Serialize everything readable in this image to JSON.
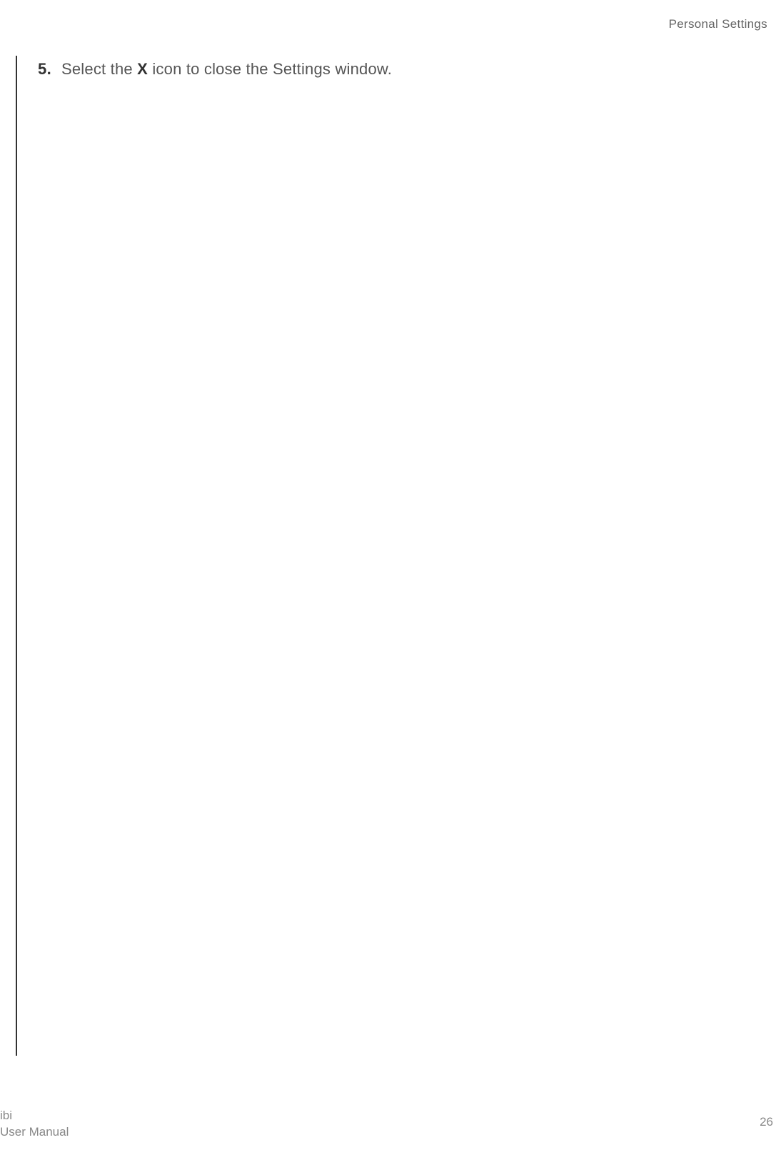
{
  "header": {
    "section_title": "Personal Settings"
  },
  "content": {
    "step_number": "5.",
    "step_text_before": "Select the ",
    "step_text_bold": "X",
    "step_text_after": " icon to close the Settings window."
  },
  "footer": {
    "product": "ibi",
    "doc_title": "User Manual",
    "page_number": "26"
  }
}
